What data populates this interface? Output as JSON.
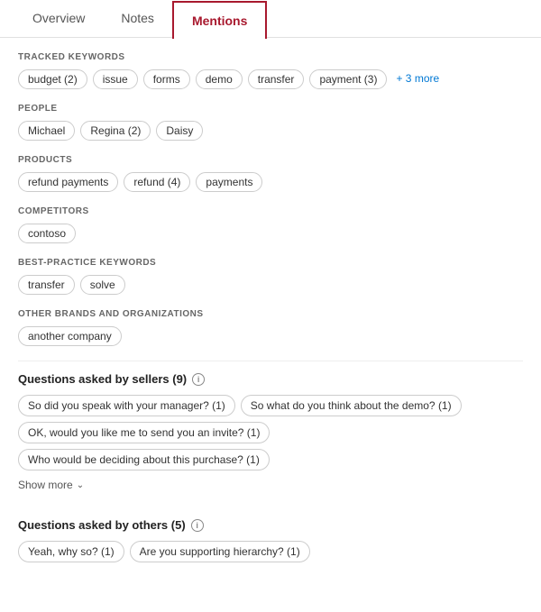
{
  "tabs": {
    "overview": "Overview",
    "notes": "Notes",
    "mentions": "Mentions"
  },
  "sections": {
    "tracked_keywords": {
      "label": "TRACKED KEYWORDS",
      "tags": [
        "budget (2)",
        "issue",
        "forms",
        "demo",
        "transfer",
        "payment (3)"
      ],
      "more": "+ 3 more"
    },
    "people": {
      "label": "PEOPLE",
      "tags": [
        "Michael",
        "Regina (2)",
        "Daisy"
      ]
    },
    "products": {
      "label": "PRODUCTS",
      "tags": [
        "refund payments",
        "refund (4)",
        "payments"
      ]
    },
    "competitors": {
      "label": "COMPETITORS",
      "tags": [
        "contoso"
      ]
    },
    "best_practice": {
      "label": "BEST-PRACTICE KEYWORDS",
      "tags": [
        "transfer",
        "solve"
      ]
    },
    "other_brands": {
      "label": "OTHER BRANDS AND ORGANIZATIONS",
      "tags": [
        "another company"
      ]
    }
  },
  "questions_sellers": {
    "header": "Questions asked by sellers (9)",
    "info": "i",
    "tags": [
      "So did you speak with your manager? (1)",
      "So what do you think about the demo? (1)",
      "OK, would you like me to send you an invite? (1)",
      "Who would be deciding about this purchase? (1)"
    ],
    "show_more": "Show more"
  },
  "questions_others": {
    "header": "Questions asked by others (5)",
    "info": "i",
    "tags": [
      "Yeah, why so? (1)",
      "Are you supporting hierarchy? (1)"
    ]
  }
}
